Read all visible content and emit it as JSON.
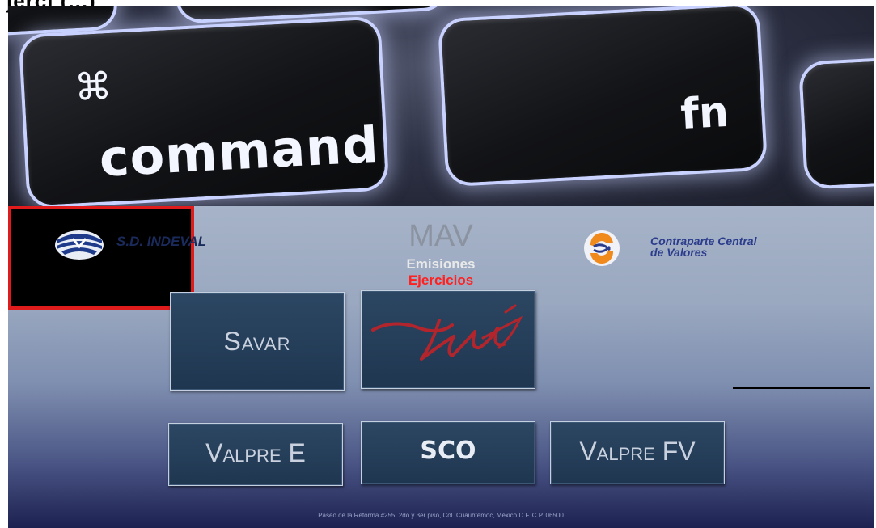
{
  "header": {
    "title_fragment": "jerci  (...)"
  },
  "keyboard": {
    "command_symbol": "⌘",
    "command_label": "command",
    "fn_label": "fn"
  },
  "logos": {
    "indeval": "S.D. INDEVAL",
    "ccv_line1": "Contraparte Central",
    "ccv_line2": "de Valores"
  },
  "tiles": {
    "savar": "Savar",
    "mav_title": "MAV",
    "mav_emisiones": "Emisiones",
    "mav_ejercicios": "Ejercicios",
    "valpre_e": "Valpre E",
    "sco": "SCO",
    "valpre_fv": "Valpre FV"
  },
  "footer": {
    "address": "Paseo de la Reforma #255, 2do y 3er piso, Col. Cuauhtémoc, México D.F. C.P. 06500"
  },
  "colors": {
    "panel_top": "#a6b3c8",
    "panel_bottom": "#1c2150",
    "tile": "#24405c",
    "highlight_border": "#e01b1b",
    "ejercicios": "#ff2020"
  }
}
